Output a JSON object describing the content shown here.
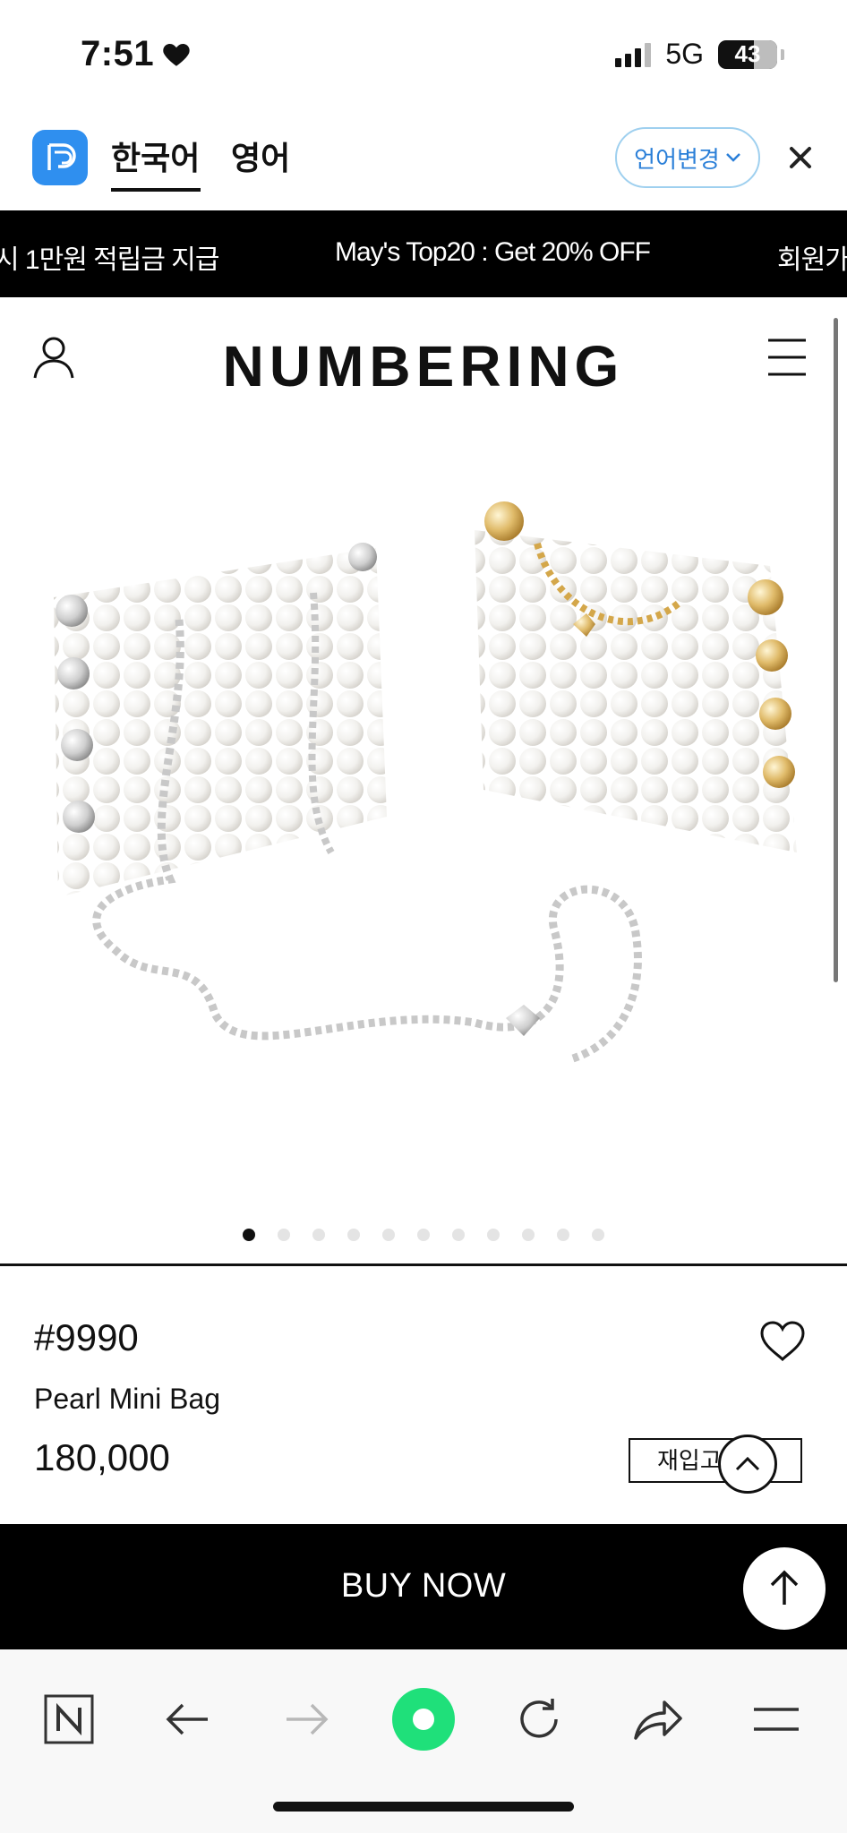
{
  "status_bar": {
    "time": "7:51",
    "network": "5G",
    "battery": "43"
  },
  "translate_bar": {
    "active_language": "한국어",
    "other_language": "영어",
    "change_language_label": "언어변경"
  },
  "announcement": {
    "items": [
      "시 1만원 적립금 지급",
      "May's Top20 : Get 20% OFF",
      "회원가입"
    ]
  },
  "header": {
    "brand": "NUMBERING"
  },
  "gallery": {
    "total_slides": 11,
    "active_slide": 1
  },
  "product": {
    "number": "#9990",
    "name": "Pearl Mini Bag",
    "price": "180,000",
    "restock_label": "재입고 알림"
  },
  "buy_bar": {
    "label": "BUY NOW"
  },
  "colors": {
    "brand_logo_blue": "#2f8fef",
    "language_button_text": "#2a7fd8",
    "record_button_green": "#1fe07a"
  },
  "icons": {
    "status": [
      "heart-icon",
      "signal-icon",
      "battery-icon"
    ],
    "header": [
      "user-icon",
      "menu-icon"
    ],
    "toolbar": [
      "naver-n-icon",
      "back-arrow-icon",
      "forward-arrow-icon",
      "green-dot-icon",
      "reload-icon",
      "share-icon",
      "hamburger-icon"
    ]
  }
}
